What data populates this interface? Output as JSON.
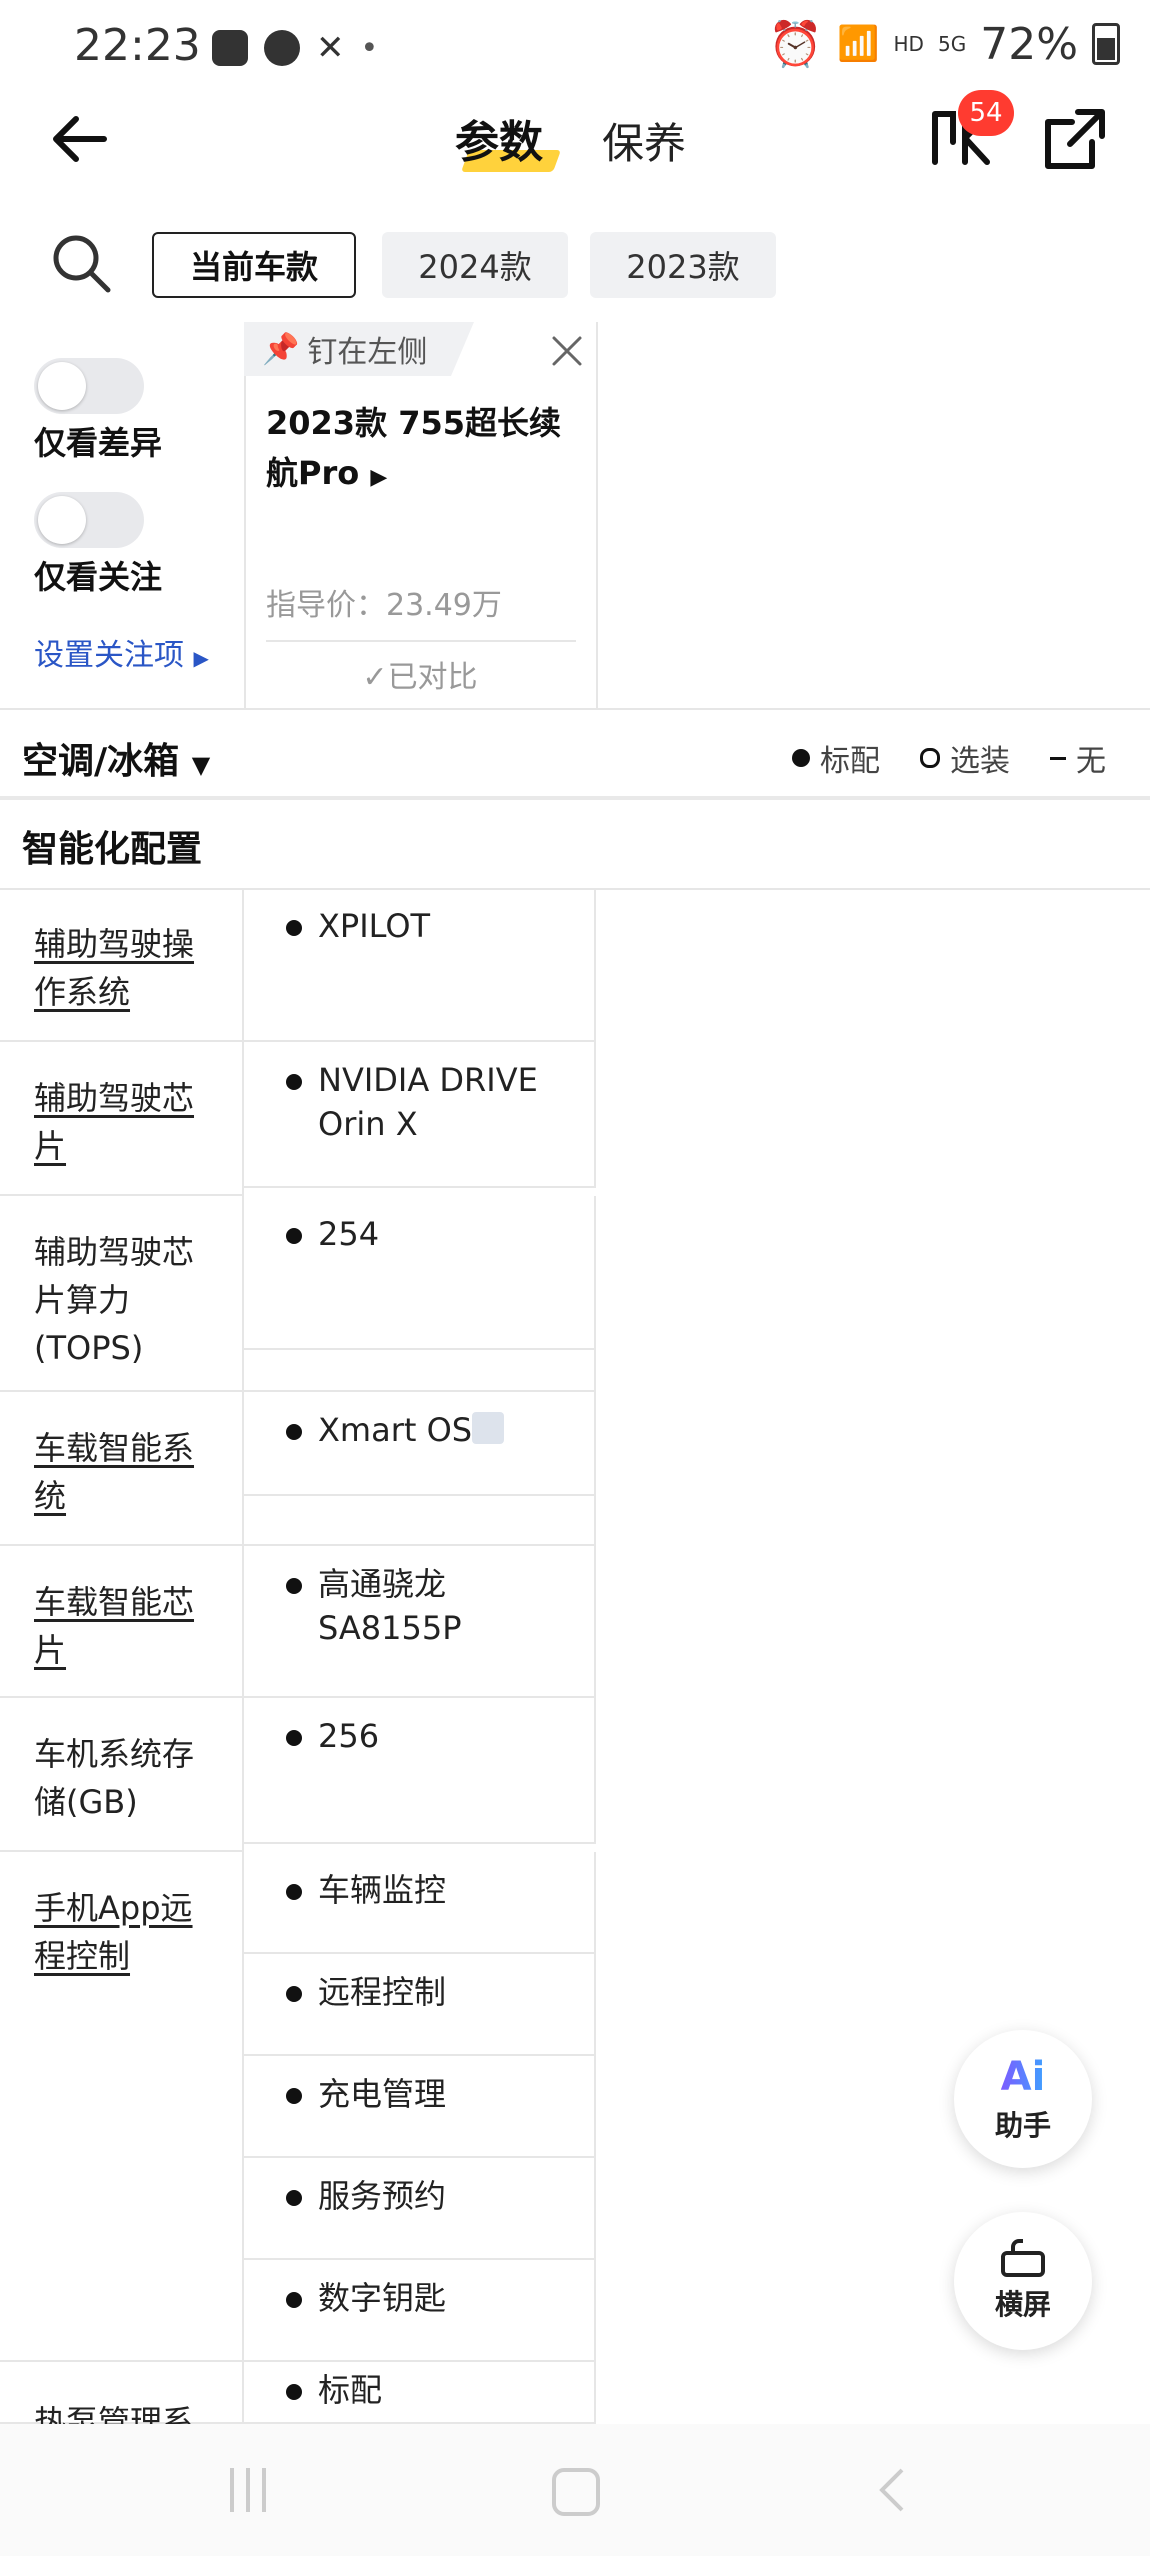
{
  "status": {
    "time": "22:23",
    "battery": "72%",
    "network": "5G",
    "hd": "HD"
  },
  "header": {
    "tabs": [
      {
        "label": "参数",
        "active": true
      },
      {
        "label": "保养",
        "active": false
      }
    ],
    "compare_badge": "54"
  },
  "filters": {
    "chips": [
      "当前车款",
      "2024款",
      "2023款"
    ],
    "selected": "当前车款"
  },
  "controls": {
    "only_diff": "仅看差异",
    "only_follow": "仅看关注",
    "set_follow": "设置关注项"
  },
  "car_card": {
    "pin_label": "钉在左侧",
    "title": "2023款 755超长续航Pro",
    "price": "指导价：23.49万",
    "compared": "已对比"
  },
  "section": {
    "title": "空调/冰箱",
    "legend": [
      {
        "icon": "filled-dot",
        "label": "标配"
      },
      {
        "icon": "empty-dot",
        "label": "选装"
      },
      {
        "icon": "dash",
        "label": "无"
      }
    ]
  },
  "group": {
    "title": "智能化配置"
  },
  "rows": [
    {
      "label": "辅助驾驶操作系统",
      "values": [
        "XPILOT"
      ]
    },
    {
      "label": "辅助驾驶芯片",
      "values": [
        "NVIDIA DRIVE Orin X"
      ]
    },
    {
      "label": "辅助驾驶芯片算力(TOPS)",
      "values": [
        "254"
      ]
    },
    {
      "label": "车载智能系统",
      "values": [
        "Xmart OS"
      ]
    },
    {
      "label": "车载智能芯片",
      "values": [
        "高通骁龙SA8155P"
      ]
    },
    {
      "label": "车机系统存储(GB)",
      "values": [
        "256"
      ]
    },
    {
      "label": "手机App远程控制",
      "values": [
        "车辆监控",
        "远程控制",
        "充电管理",
        "服务预约",
        "数字钥匙"
      ]
    },
    {
      "label": "热泵管理系",
      "values": [
        "标配"
      ]
    }
  ],
  "fabs": {
    "ai_label": "助手",
    "rotate_label": "横屏"
  },
  "colors": {
    "accent_underline": "#ffd23c",
    "badge": "#ff3b30",
    "link": "#2a56c6"
  }
}
